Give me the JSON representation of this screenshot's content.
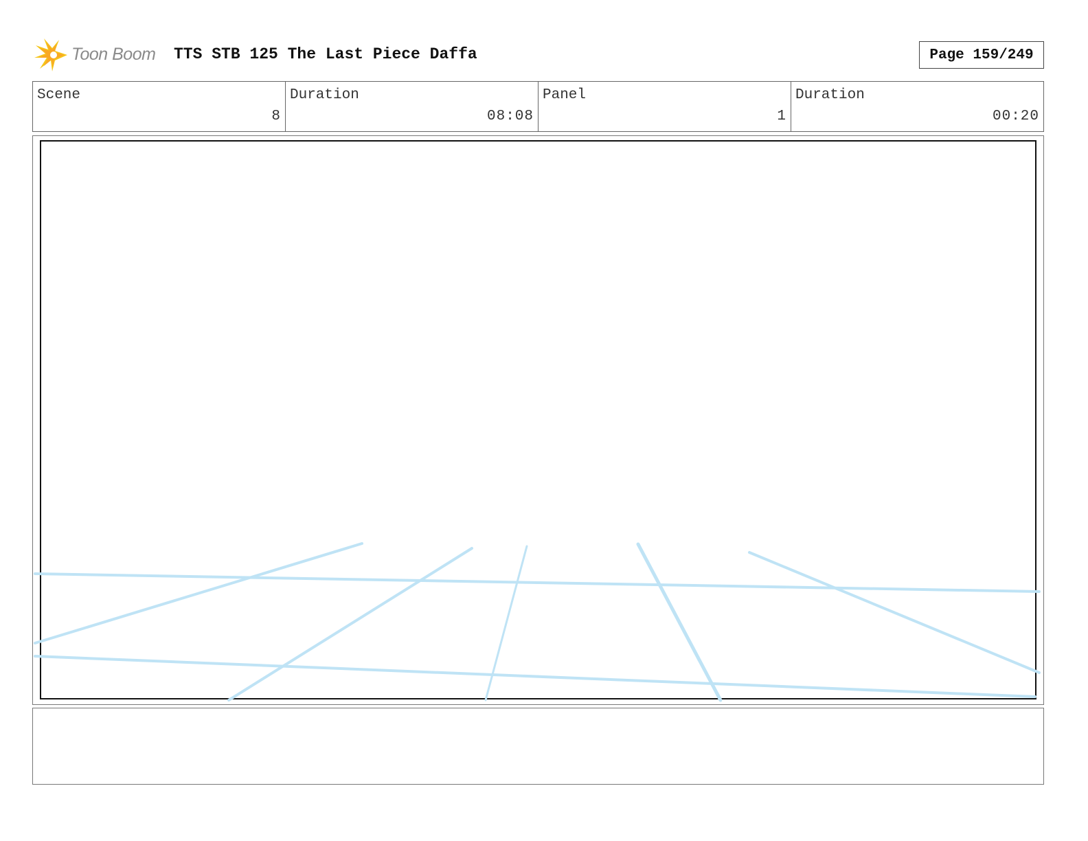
{
  "header": {
    "logo_text": "Toon Boom",
    "title": "TTS STB 125 The Last Piece Daffa",
    "page_label": "Page 159/249"
  },
  "info": {
    "scene_label": "Scene",
    "scene_value": "8",
    "scene_duration_label": "Duration",
    "scene_duration_value": "08:08",
    "panel_label": "Panel",
    "panel_value": "1",
    "panel_duration_label": "Duration",
    "panel_duration_value": "00:20"
  },
  "notes": {
    "text": ""
  },
  "colors": {
    "logo_star": "#f5c518",
    "logo_text": "#8a8a8a",
    "sketch_lines": "#bfe3f5",
    "frame_border": "#111111"
  }
}
